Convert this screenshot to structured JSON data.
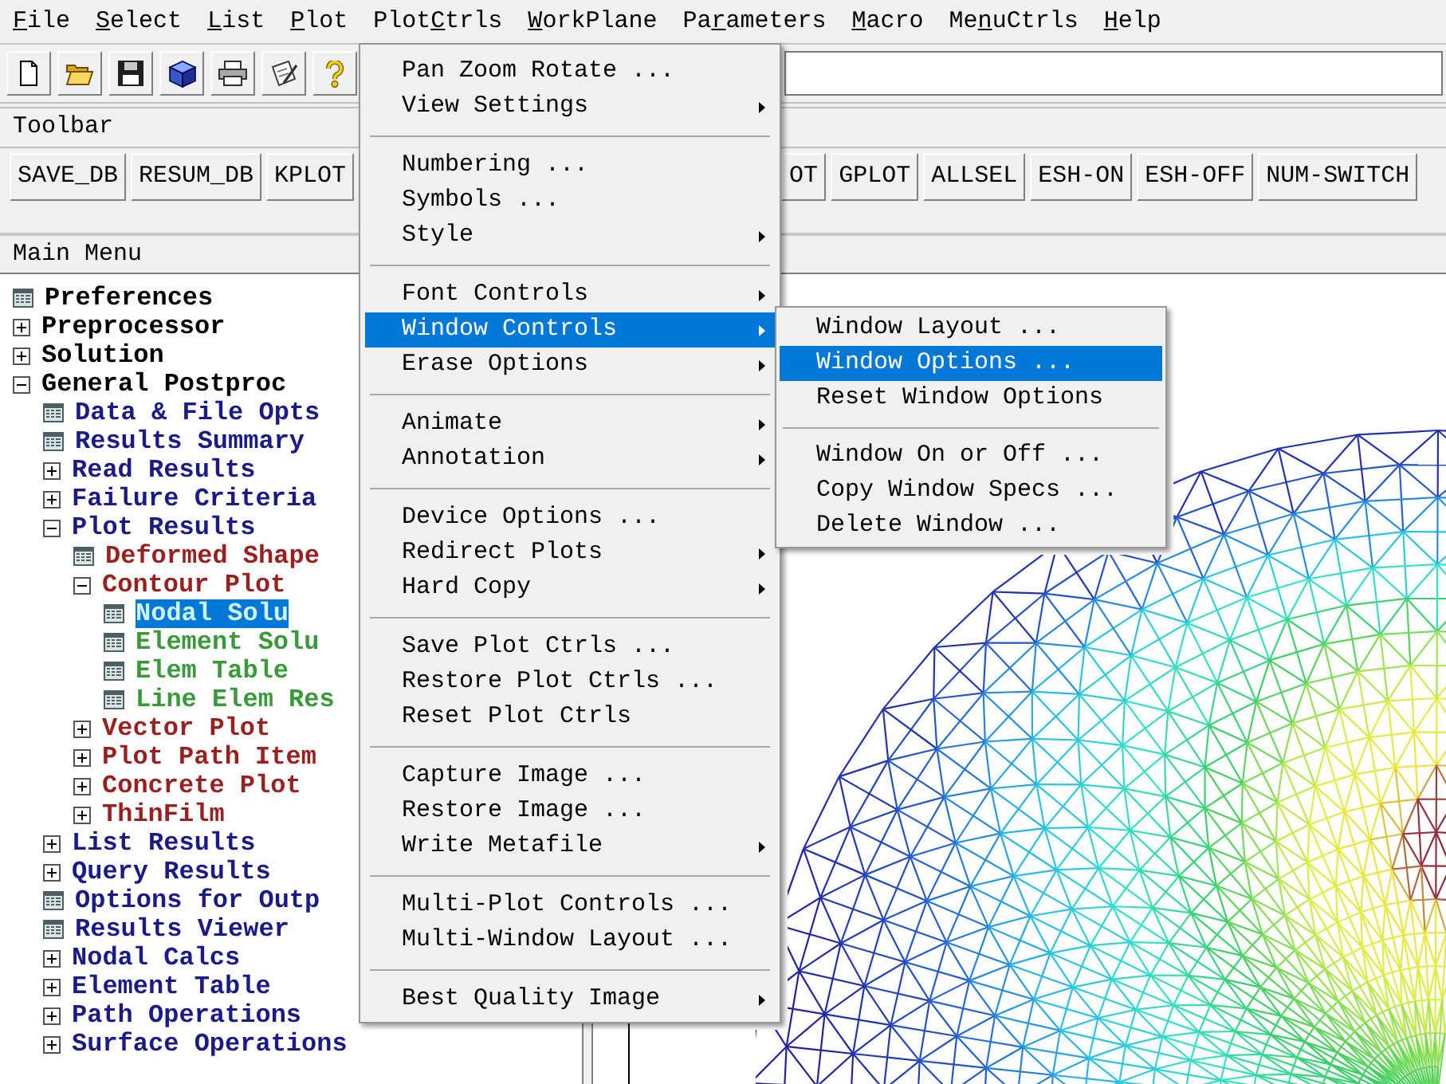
{
  "menu_bar": [
    {
      "key": "F",
      "after": "ile"
    },
    {
      "key": "S",
      "after": "elect"
    },
    {
      "key": "L",
      "after": "ist"
    },
    {
      "key": "P",
      "after": "lot"
    },
    {
      "before": "Plot",
      "key": "C",
      "after": "trls"
    },
    {
      "key": "W",
      "after": "orkPlane"
    },
    {
      "before": "Pa",
      "key": "r",
      "after": "ameters"
    },
    {
      "key": "M",
      "after": "acro"
    },
    {
      "before": "Me",
      "key": "n",
      "after": "uCtrls"
    },
    {
      "key": "H",
      "after": "elp"
    }
  ],
  "toolbar": {
    "title": "Toolbar",
    "buttons_left": [
      "SAVE_DB",
      "RESUM_DB",
      "KPLOT"
    ],
    "buttons_right": [
      "OT",
      "GPLOT",
      "ALLSEL",
      "ESH-ON",
      "ESH-OFF",
      "NUM-SWITCH"
    ]
  },
  "main_menu": {
    "title": "Main Menu",
    "tree": [
      {
        "label": "Preferences",
        "kind": "command",
        "color": "#000000",
        "selected": false
      },
      {
        "label": "Preprocessor",
        "kind": "folder",
        "expanded": false,
        "color": "#000000",
        "selected": false
      },
      {
        "label": "Solution",
        "kind": "folder",
        "expanded": false,
        "color": "#000000",
        "selected": false
      },
      {
        "label": "General Postproc",
        "kind": "folder",
        "expanded": true,
        "color": "#000000",
        "selected": false,
        "children": [
          {
            "label": "Data & File Opts",
            "kind": "command",
            "color": "#1a1a88",
            "selected": false
          },
          {
            "label": "Results Summary",
            "kind": "command",
            "color": "#1a1a88",
            "selected": false
          },
          {
            "label": "Read Results",
            "kind": "folder",
            "expanded": false,
            "color": "#1a1a88",
            "selected": false
          },
          {
            "label": "Failure Criteria",
            "kind": "folder",
            "expanded": false,
            "color": "#1a1a88",
            "selected": false
          },
          {
            "label": "Plot Results",
            "kind": "folder",
            "expanded": true,
            "color": "#1a1a88",
            "selected": false,
            "children": [
              {
                "label": "Deformed Shape",
                "kind": "command",
                "color": "#9a1f1f",
                "selected": false
              },
              {
                "label": "Contour Plot",
                "kind": "folder",
                "expanded": true,
                "color": "#9a1f1f",
                "selected": false,
                "children": [
                  {
                    "label": "Nodal Solu",
                    "kind": "command",
                    "selected": true
                  },
                  {
                    "label": "Element Solu",
                    "kind": "command",
                    "color": "#3a9a3a",
                    "selected": false
                  },
                  {
                    "label": "Elem Table",
                    "kind": "command",
                    "color": "#3a9a3a",
                    "selected": false
                  },
                  {
                    "label": "Line Elem Res",
                    "kind": "command",
                    "color": "#3a9a3a",
                    "selected": false
                  }
                ]
              },
              {
                "label": "Vector Plot",
                "kind": "folder",
                "expanded": false,
                "color": "#9a1f1f",
                "selected": false
              },
              {
                "label": "Plot Path Item",
                "kind": "folder",
                "expanded": false,
                "color": "#9a1f1f",
                "selected": false
              },
              {
                "label": "Concrete Plot",
                "kind": "folder",
                "expanded": false,
                "color": "#9a1f1f",
                "selected": false
              },
              {
                "label": "ThinFilm",
                "kind": "folder",
                "expanded": false,
                "color": "#9a1f1f",
                "selected": false
              }
            ]
          },
          {
            "label": "List Results",
            "kind": "folder",
            "expanded": false,
            "color": "#1a1a88",
            "selected": false
          },
          {
            "label": "Query Results",
            "kind": "folder",
            "expanded": false,
            "color": "#1a1a88",
            "selected": false
          },
          {
            "label": "Options for Outp",
            "kind": "command",
            "color": "#1a1a88",
            "selected": false
          },
          {
            "label": "Results Viewer",
            "kind": "command",
            "color": "#1a1a88",
            "selected": false
          },
          {
            "label": "Nodal Calcs",
            "kind": "folder",
            "expanded": false,
            "color": "#1a1a88",
            "selected": false
          },
          {
            "label": "Element Table",
            "kind": "folder",
            "expanded": false,
            "color": "#1a1a88",
            "selected": false
          },
          {
            "label": "Path Operations",
            "kind": "folder",
            "expanded": false,
            "color": "#1a1a88",
            "selected": false
          },
          {
            "label": "Surface Operations",
            "kind": "folder",
            "expanded": false,
            "color": "#1a1a88",
            "selected": false
          }
        ]
      }
    ]
  },
  "plotctrls_menu": {
    "groups": [
      [
        {
          "label": "Pan Zoom Rotate ...",
          "submenu": false,
          "selected": false
        },
        {
          "label": "View Settings",
          "submenu": true,
          "selected": false
        }
      ],
      [
        {
          "label": "Numbering ...",
          "submenu": false,
          "selected": false
        },
        {
          "label": "Symbols ...",
          "submenu": false,
          "selected": false
        },
        {
          "label": "Style",
          "submenu": true,
          "selected": false
        }
      ],
      [
        {
          "label": "Font Controls",
          "submenu": true,
          "selected": false
        },
        {
          "label": "Window Controls",
          "submenu": true,
          "selected": true
        },
        {
          "label": "Erase Options",
          "submenu": true,
          "selected": false
        }
      ],
      [
        {
          "label": "Animate",
          "submenu": true,
          "selected": false
        },
        {
          "label": "Annotation",
          "submenu": true,
          "selected": false
        }
      ],
      [
        {
          "label": "Device Options ...",
          "submenu": false,
          "selected": false
        },
        {
          "label": "Redirect Plots",
          "submenu": true,
          "selected": false
        },
        {
          "label": "Hard Copy",
          "submenu": true,
          "selected": false
        }
      ],
      [
        {
          "label": "Save Plot Ctrls ...",
          "submenu": false,
          "selected": false
        },
        {
          "label": "Restore Plot Ctrls ...",
          "submenu": false,
          "selected": false
        },
        {
          "label": "Reset Plot Ctrls",
          "submenu": false,
          "selected": false
        }
      ],
      [
        {
          "label": "Capture Image ...",
          "submenu": false,
          "selected": false
        },
        {
          "label": "Restore Image ...",
          "submenu": false,
          "selected": false
        },
        {
          "label": "Write Metafile",
          "submenu": true,
          "selected": false
        }
      ],
      [
        {
          "label": "Multi-Plot Controls ...",
          "submenu": false,
          "selected": false
        },
        {
          "label": "Multi-Window Layout ...",
          "submenu": false,
          "selected": false
        }
      ],
      [
        {
          "label": "Best Quality Image",
          "submenu": true,
          "selected": false
        }
      ]
    ]
  },
  "window_controls_submenu": {
    "groups": [
      [
        {
          "label": "Window Layout ...",
          "selected": false
        },
        {
          "label": "Window Options ...",
          "selected": true
        },
        {
          "label": "Reset Window Options",
          "selected": false
        }
      ],
      [
        {
          "label": "Window On or Off ...",
          "selected": false
        },
        {
          "label": "Copy Window Specs ...",
          "selected": false
        },
        {
          "label": "Delete Window ...",
          "selected": false
        }
      ]
    ]
  }
}
